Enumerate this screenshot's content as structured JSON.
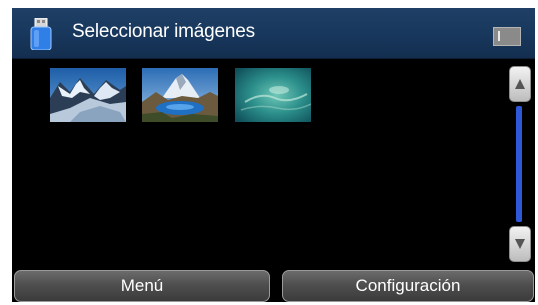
{
  "header": {
    "title": "Seleccionar imágenes",
    "icon": "usb-drive-icon",
    "status_icon": "page-indicator-icon"
  },
  "thumbnails": [
    {
      "name": "photo-glacier-mountains",
      "selected": false
    },
    {
      "name": "photo-mountain-lake",
      "selected": false
    },
    {
      "name": "photo-aerial-ocean",
      "selected": false
    }
  ],
  "scrollbar": {
    "up_icon": "arrow-up-icon",
    "down_icon": "arrow-down-icon"
  },
  "footer": {
    "left_label": "Menú",
    "right_label": "Configuración"
  },
  "colors": {
    "title_bar": "#1a395f",
    "scroll_thumb": "#2d58d8",
    "background": "#000000"
  }
}
